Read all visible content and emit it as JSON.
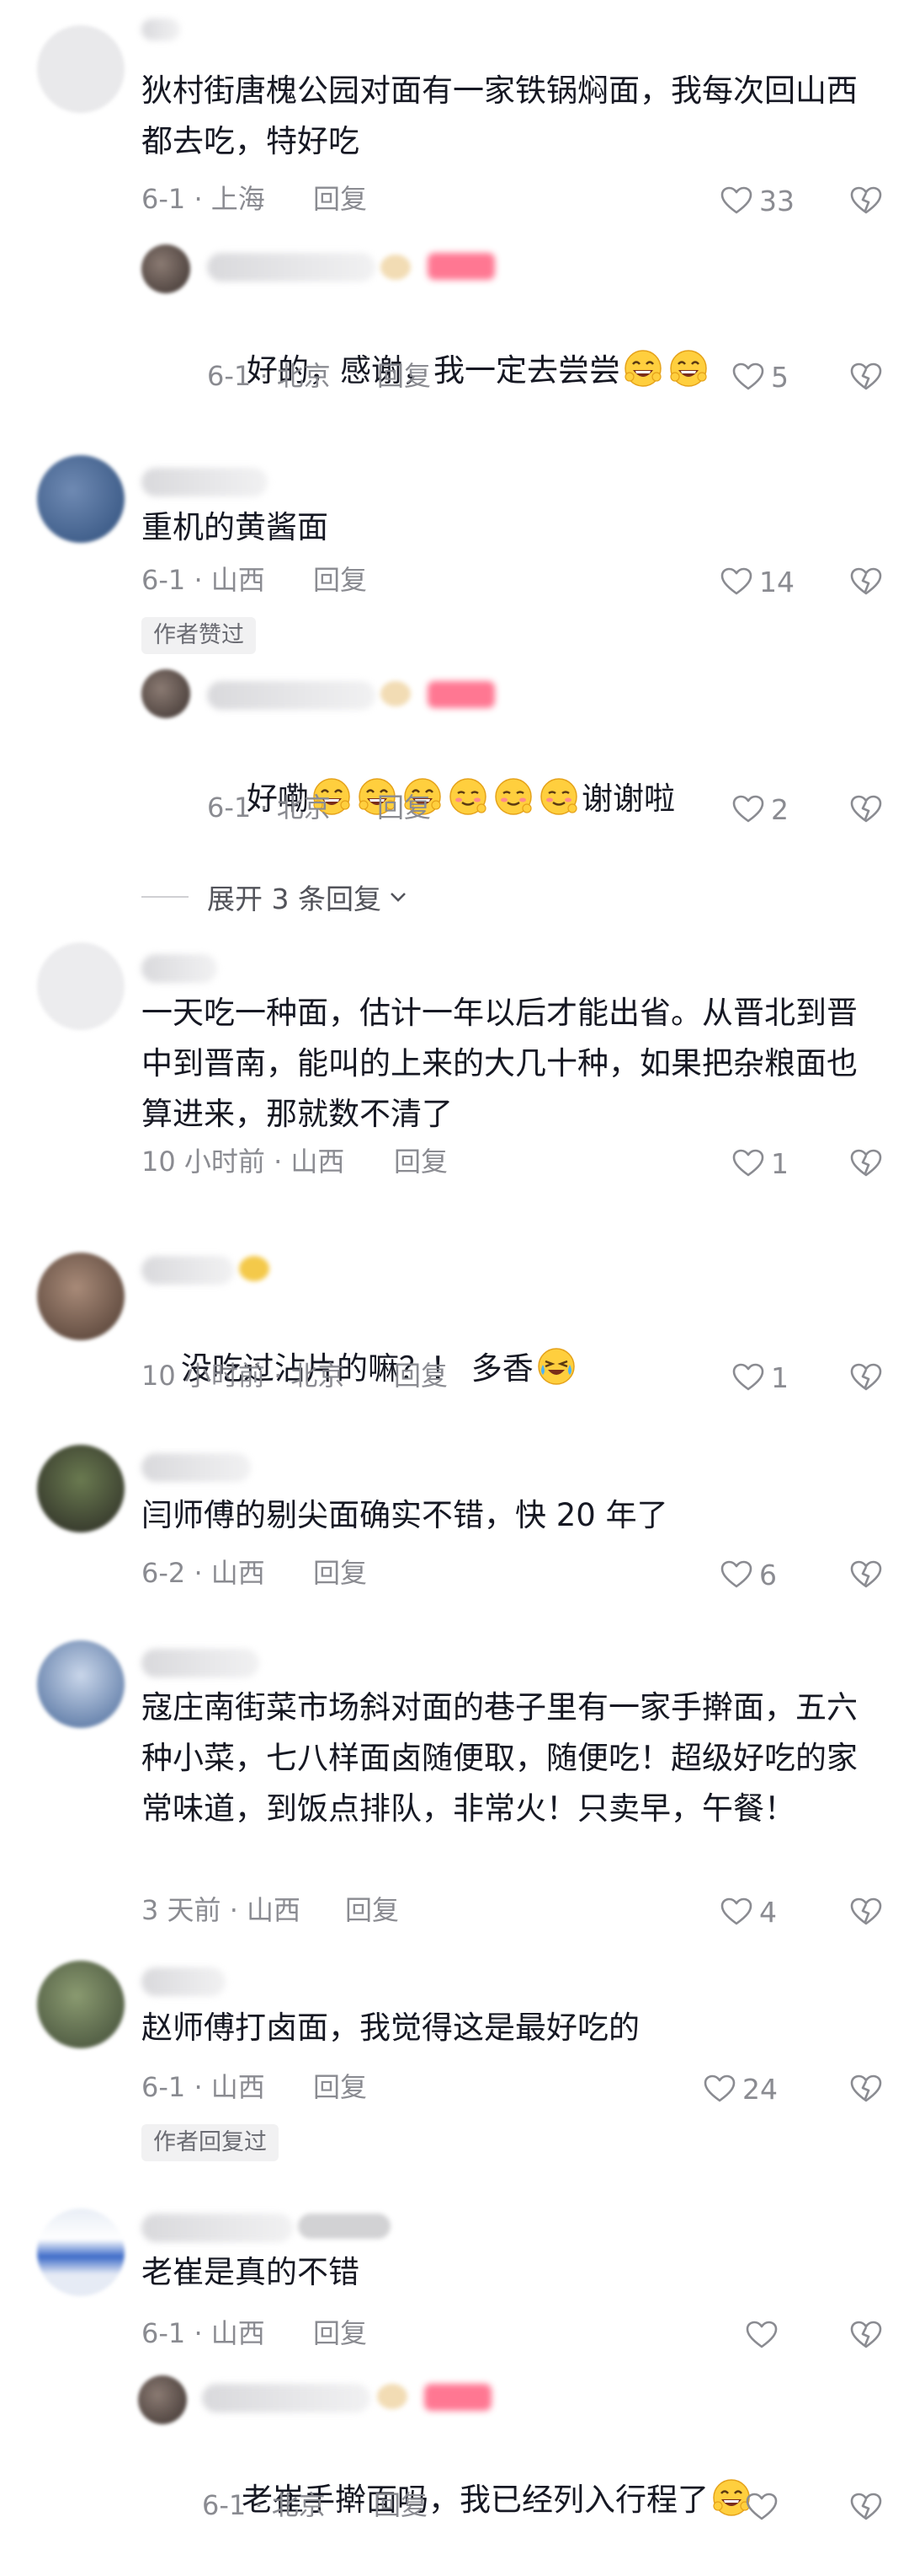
{
  "comments": [
    {
      "text": "狄村街唐槐公园对面有一家铁锅焖面，我每次回山西都去吃，特好吃",
      "meta": "6-1 · 上海",
      "reply": "回复",
      "likes": "33",
      "replies": [
        {
          "text": "好的，感谢，我一定去尝尝",
          "meta": "6-1 · 北京",
          "reply": "回复",
          "likes": "5"
        }
      ]
    },
    {
      "text": "重机的黄酱面",
      "meta": "6-1 · 山西",
      "reply": "回复",
      "likes": "14",
      "badge": "作者赞过",
      "replies": [
        {
          "text_prefix": "好嘞",
          "text_suffix": "谢谢啦",
          "meta": "6-1 · 北京",
          "reply": "回复",
          "likes": "2"
        }
      ],
      "expand": "展开 3 条回复"
    },
    {
      "text": "一天吃一种面，估计一年以后才能出省。从晋北到晋中到晋南，能叫的上来的大几十种，如果把杂粮面也算进来，那就数不清了",
      "meta": "10 小时前 · 山西",
      "reply": "回复",
      "likes": "1"
    },
    {
      "text": "没吃过沾片的嘛？！ 多香",
      "meta": "10 小时前 · 北京",
      "reply": "回复",
      "likes": "1"
    },
    {
      "text": "闫师傅的剔尖面确实不错，快 20 年了",
      "meta": "6-2 · 山西",
      "reply": "回复",
      "likes": "6"
    },
    {
      "text": "寇庄南街菜市场斜对面的巷子里有一家手擀面，五六种小菜，七八样面卤随便取，随便吃！超级好吃的家常味道，到饭点排队，非常火！只卖早，午餐！",
      "meta": "3 天前 · 山西",
      "reply": "回复",
      "likes": "4"
    },
    {
      "text": "赵师傅打卤面，我觉得这是最好吃的",
      "meta": "6-1 · 山西",
      "reply": "回复",
      "likes": "24",
      "badge": "作者回复过"
    },
    {
      "text": "老崔是真的不错",
      "meta": "6-1 · 山西",
      "reply": "回复",
      "likes": "",
      "replies": [
        {
          "text": "老崔手擀面吗，我已经列入行程了",
          "meta": "6-1 · 北京",
          "reply": "回复",
          "likes": ""
        }
      ]
    }
  ],
  "icons": {
    "like": "heart-outline-icon",
    "dislike": "broken-heart-icon",
    "expand": "chevron-down-icon",
    "emoji_laugh": "grin-emoji",
    "emoji_hug": "hug-emoji",
    "emoji_blush": "blush-emoji",
    "emoji_cry": "laugh-cry-emoji"
  },
  "colors": {
    "text": "#161823",
    "meta": "#8a8b91",
    "badge_bg": "#f1f1f2",
    "tag": "#ff4a6e"
  }
}
